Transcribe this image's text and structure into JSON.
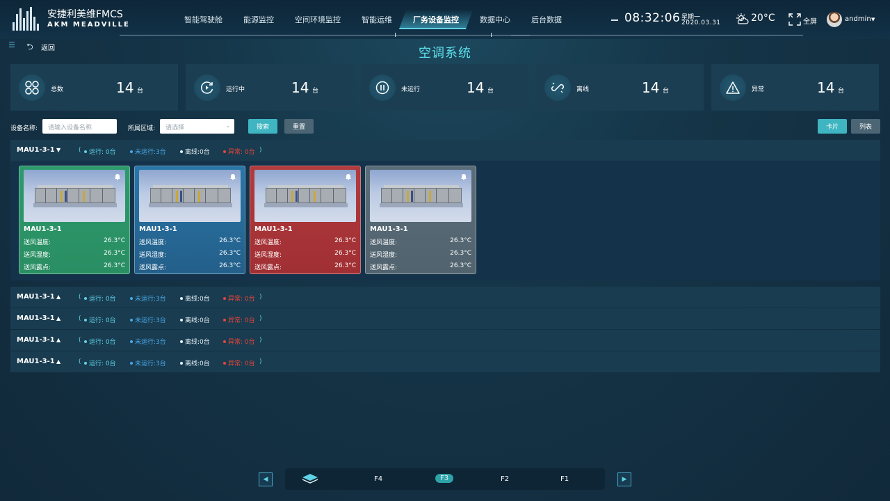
{
  "header": {
    "logo_cn": "安捷利美维FMCS",
    "logo_en": "AKM MEADVILLE",
    "nav": [
      "智能驾驶舱",
      "能源监控",
      "空间环境监控",
      "智能运维",
      "厂务设备监控",
      "数据中心",
      "后台数据"
    ],
    "active_nav_index": 4,
    "time": "08:32:06",
    "weekday": "星期一",
    "date": "2020.03.31",
    "temperature": "20°C",
    "weather_icon": "cloudy-sun-icon",
    "fullscreen_label": "全屏",
    "user": "andmin"
  },
  "subbar": {
    "back_label": "返回",
    "page_title": "空调系统"
  },
  "stats": [
    {
      "label": "总数",
      "value": "14",
      "unit": "台",
      "icon": "grid-icon"
    },
    {
      "label": "运行中",
      "value": "14",
      "unit": "台",
      "icon": "running-icon"
    },
    {
      "label": "未运行",
      "value": "14",
      "unit": "台",
      "icon": "pause-icon"
    },
    {
      "label": "离线",
      "value": "14",
      "unit": "台",
      "icon": "link-broken-icon"
    },
    {
      "label": "异常",
      "value": "14",
      "unit": "台",
      "icon": "warning-icon"
    }
  ],
  "filter": {
    "name_label": "设备名称:",
    "name_placeholder": "请输入设备名称",
    "area_label": "所属区域:",
    "area_placeholder": "请选择",
    "search_label": "搜索",
    "reset_label": "重置",
    "view_card_label": "卡片",
    "view_list_label": "列表"
  },
  "groups": [
    {
      "name": "MAU1-3-1",
      "expanded": true,
      "run": "运行: 0台",
      "stop": "未运行:3台",
      "off": "离线:0台",
      "err": "异常: 0台"
    },
    {
      "name": "MAU1-3-1",
      "expanded": false,
      "run": "运行: 0台",
      "stop": "未运行:3台",
      "off": "离线:0台",
      "err": "异常: 0台"
    },
    {
      "name": "MAU1-3-1",
      "expanded": false,
      "run": "运行: 0台",
      "stop": "未运行:3台",
      "off": "离线:0台",
      "err": "异常: 0台"
    },
    {
      "name": "MAU1-3-1",
      "expanded": false,
      "run": "运行: 0台",
      "stop": "未运行:3台",
      "off": "离线:0台",
      "err": "异常: 0台"
    },
    {
      "name": "MAU1-3-1",
      "expanded": false,
      "run": "运行: 0台",
      "stop": "未运行:3台",
      "off": "离线:0台",
      "err": "异常: 0台"
    }
  ],
  "cards": [
    {
      "title": "MAU1-3-1",
      "status": "green",
      "rows": [
        {
          "label": "送风温度:",
          "value": "26.3°C"
        },
        {
          "label": "送风湿度:",
          "value": "26.3°C"
        },
        {
          "label": "送风露点:",
          "value": "26.3°C"
        }
      ]
    },
    {
      "title": "MAU1-3-1",
      "status": "blue",
      "rows": [
        {
          "label": "送风温度:",
          "value": "26.3°C"
        },
        {
          "label": "送风湿度:",
          "value": "26.3°C"
        },
        {
          "label": "送风露点:",
          "value": "26.3°C"
        }
      ]
    },
    {
      "title": "MAU1-3-1",
      "status": "red",
      "rows": [
        {
          "label": "送风温度:",
          "value": "26.3°C"
        },
        {
          "label": "送风湿度:",
          "value": "26.3°C"
        },
        {
          "label": "送风露点:",
          "value": "26.3°C"
        }
      ]
    },
    {
      "title": "MAU1-3-1",
      "status": "gray",
      "rows": [
        {
          "label": "送风温度:",
          "value": "26.3°C"
        },
        {
          "label": "送风湿度:",
          "value": "26.3°C"
        },
        {
          "label": "送风露点:",
          "value": "26.3°C"
        }
      ]
    }
  ],
  "pager": {
    "floors": [
      "F4",
      "F3",
      "F2",
      "F1"
    ],
    "active_floor": "F3",
    "prev": "◀",
    "next": "▶"
  },
  "colors": {
    "accent": "#5fd2e6",
    "run": "#5fd2e6",
    "stop": "#4aa8e8",
    "offline": "#e6f0f6",
    "error": "#e6453a",
    "card_green": "#2c9a6c",
    "card_blue": "#2976a8",
    "card_red": "#b23b3e",
    "card_gray": "#5a6d79"
  }
}
